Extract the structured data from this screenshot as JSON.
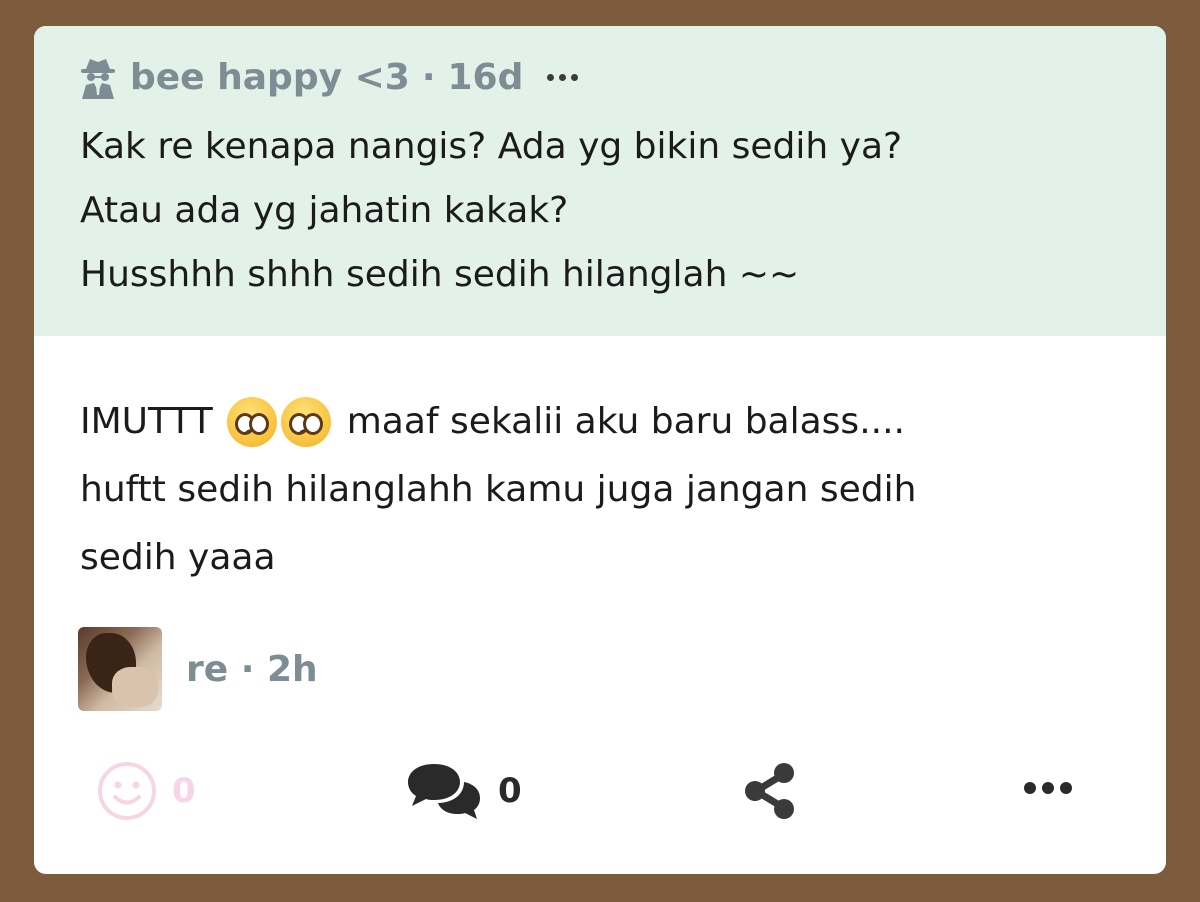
{
  "question": {
    "author": "bee happy <3",
    "separator": "·",
    "age": "16d",
    "icon": "spy-icon",
    "lines": [
      "Kak re kenapa nangis? Ada yg bikin sedih ya?",
      "Atau ada yg jahatin kakak?",
      "Husshhh shhh sedih sedih hilanglah ~~"
    ]
  },
  "answer": {
    "line1_prefix": "IMUTTT",
    "line1_suffix": "maaf sekalii aku baru balass....",
    "line2": "huftt sedih hilanglahh kamu juga jangan sedih",
    "line3": "sedih yaaa",
    "emoji": "pleading-face-emoji"
  },
  "author": {
    "name": "re",
    "separator": "·",
    "age": "2h"
  },
  "actions": {
    "react_count": "0",
    "comment_count": "0"
  },
  "colors": {
    "background": "#7d5c3d",
    "question_bg": "#e2f2e9",
    "meta_text": "#7e8c93",
    "react_icon": "#f6d6e6"
  }
}
